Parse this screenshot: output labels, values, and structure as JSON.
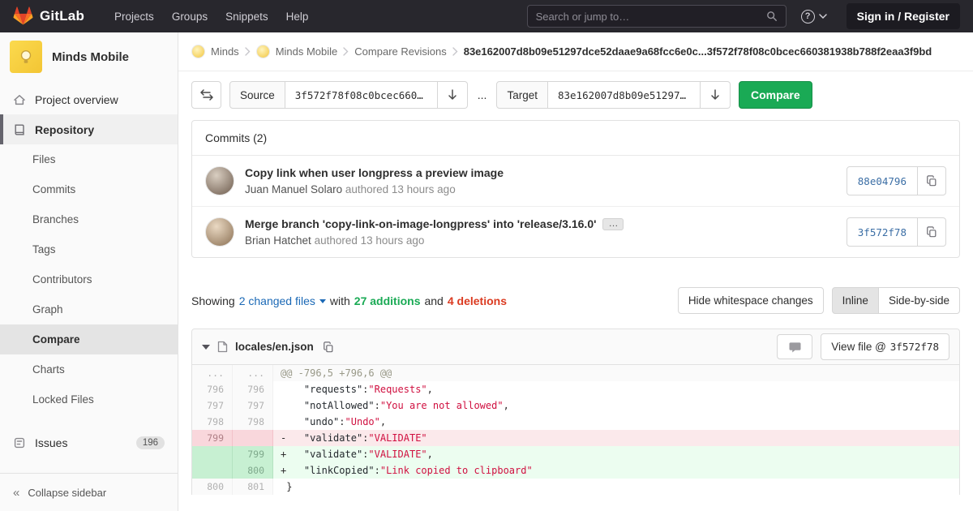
{
  "colors": {
    "brand_orange": "#fc6d26",
    "navbar_bg": "#28272d",
    "compare_button_green": "#1aaa55",
    "additions_green": "#1aaa55",
    "deletions_red": "#db3b21",
    "link_blue": "#1b69b6"
  },
  "icons": {
    "help_glyph": "?",
    "collapse_glyph": "«"
  },
  "navbar": {
    "logo_text": "GitLab",
    "links": [
      {
        "label": "Projects"
      },
      {
        "label": "Groups"
      },
      {
        "label": "Snippets"
      },
      {
        "label": "Help"
      }
    ],
    "search_placeholder": "Search or jump to…",
    "sign_in_label": "Sign in / Register"
  },
  "sidebar": {
    "project_name": "Minds Mobile",
    "overview_label": "Project overview",
    "repository_label": "Repository",
    "repo_items": [
      {
        "label": "Files"
      },
      {
        "label": "Commits"
      },
      {
        "label": "Branches"
      },
      {
        "label": "Tags"
      },
      {
        "label": "Contributors"
      },
      {
        "label": "Graph"
      },
      {
        "label": "Compare"
      },
      {
        "label": "Charts"
      },
      {
        "label": "Locked Files"
      }
    ],
    "issues_label": "Issues",
    "issues_count": "196",
    "collapse_label": "Collapse sidebar"
  },
  "breadcrumb": {
    "group": "Minds",
    "project": "Minds Mobile",
    "section": "Compare Revisions",
    "current": "83e162007d8b09e51297dce52daae9a68fcc6e0c...3f572f78f08c0bcec660381938b788f2eaa3f9bd"
  },
  "compare_form": {
    "source_label": "Source",
    "source_value": "3f572f78f08c0bcec660…",
    "separator": "...",
    "target_label": "Target",
    "target_value": "83e162007d8b09e51297…",
    "compare_button": "Compare"
  },
  "commits": {
    "header": "Commits (2)",
    "items": [
      {
        "title": "Copy link when user longpress a preview image",
        "author": "Juan Manuel Solaro",
        "meta": "authored 13 hours ago",
        "sha": "88e04796"
      },
      {
        "title": "Merge branch 'copy-link-on-image-longpress' into 'release/3.16.0'",
        "expander": "…",
        "author": "Brian Hatchet",
        "meta": "authored 13 hours ago",
        "sha": "3f572f78"
      }
    ]
  },
  "diff_stats": {
    "showing": "Showing",
    "changed_files": "2 changed files",
    "with_word": "with",
    "additions": "27 additions",
    "and_word": "and",
    "deletions": "4 deletions",
    "whitespace_button": "Hide whitespace changes",
    "inline_button": "Inline",
    "side_by_side_button": "Side-by-side"
  },
  "diff_file": {
    "name": "locales/en.json",
    "view_file_label": "View file @",
    "view_file_sha": "3f572f78",
    "lines": [
      {
        "old": "...",
        "new": "...",
        "code": "@@ -796,5 +796,6 @@"
      },
      {
        "old": "796",
        "new": "796",
        "sign": " ",
        "indent": "   ",
        "key": "\"requests\"",
        "sep": ":",
        "value": "\"Requests\"",
        "trail": ","
      },
      {
        "old": "797",
        "new": "797",
        "sign": " ",
        "indent": "   ",
        "key": "\"notAllowed\"",
        "sep": ":",
        "value": "\"You are not allowed\"",
        "trail": ","
      },
      {
        "old": "798",
        "new": "798",
        "sign": " ",
        "indent": "   ",
        "key": "\"undo\"",
        "sep": ":",
        "value": "\"Undo\"",
        "trail": ","
      },
      {
        "old": "799",
        "new": "",
        "sign": "-",
        "indent": "   ",
        "key": "\"validate\"",
        "sep": ":",
        "value": "\"VALIDATE\"",
        "trail": ""
      },
      {
        "old": "",
        "new": "799",
        "sign": "+",
        "indent": "   ",
        "key": "\"validate\"",
        "sep": ":",
        "value": "\"VALIDATE\"",
        "trail": ","
      },
      {
        "old": "",
        "new": "800",
        "sign": "+",
        "indent": "   ",
        "key": "\"linkCopied\"",
        "sep": ":",
        "value": "\"Link copied to clipboard\"",
        "trail": ""
      },
      {
        "old": "800",
        "new": "801",
        "sign": " ",
        "indent": "",
        "key": "",
        "sep": "",
        "value": "",
        "trail": "}"
      }
    ]
  }
}
